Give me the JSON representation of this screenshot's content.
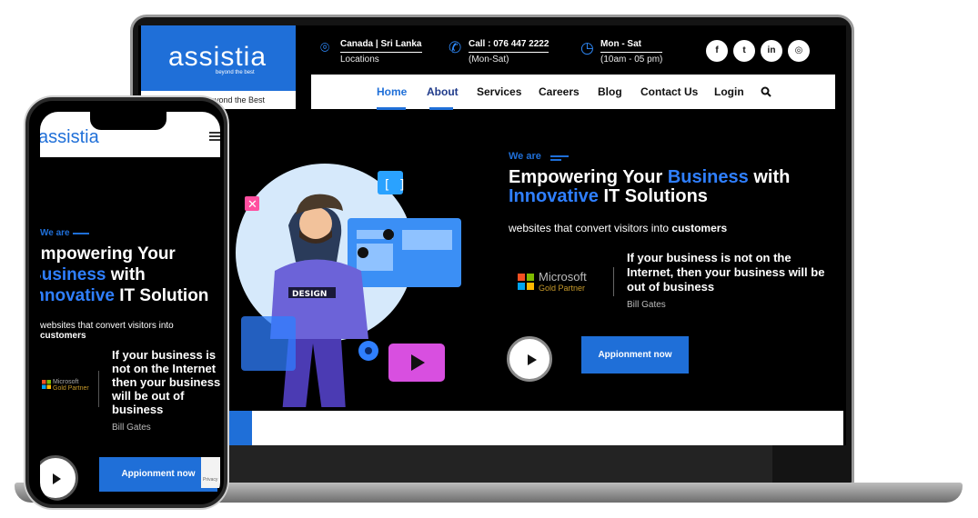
{
  "colors": {
    "brand_blue": "#1f6fd8",
    "background": "#000000",
    "accent_light": "#2f7fff"
  },
  "laptop": {
    "logo": {
      "text": "assistia",
      "sub": "beyond the best",
      "tagline": "Beyond the Best"
    },
    "contact": [
      {
        "icon": "map-pin-icon",
        "line1": "Canada | Sri Lanka",
        "line2": "Locations"
      },
      {
        "icon": "phone-icon",
        "line1": "Call : 076 447 2222",
        "line2": "(Mon-Sat)"
      },
      {
        "icon": "clock-icon",
        "line1": "Mon - Sat",
        "line2": "(10am - 05 pm)"
      }
    ],
    "social": [
      {
        "icon": "facebook-icon",
        "glyph": "f"
      },
      {
        "icon": "twitter-icon",
        "glyph": "t"
      },
      {
        "icon": "linkedin-icon",
        "glyph": "in"
      },
      {
        "icon": "instagram-icon",
        "glyph": "◎"
      }
    ],
    "nav": {
      "items": [
        "Home",
        "About",
        "Services",
        "Careers",
        "Blog",
        "Contact Us",
        "Login"
      ],
      "active": "Home",
      "search_icon": "search-icon"
    },
    "hero": {
      "eyebrow": "We are",
      "title_1": "Empowering Your ",
      "title_2": "Business",
      "title_3": " with",
      "title_4": "Innovative",
      "title_5": " IT Solutions",
      "subtitle_1": "websites that convert visitors into ",
      "subtitle_2": "customers",
      "partner_name": "Microsoft",
      "partner_level": "Gold Partner",
      "quote": "If your business is not on the Internet, then your business will be out of business",
      "quote_author": "Bill Gates",
      "cta": "Appionment now",
      "illustration_badge": "DESIGN"
    }
  },
  "phone": {
    "logo": "assistia",
    "eyebrow": "We are",
    "title_1": "Empowering Your",
    "title_2": "Business",
    "title_3": " with",
    "title_4": "Innovative",
    "title_5": " IT Solution",
    "subtitle_1": "websites that convert visitors into ",
    "subtitle_2": "customers",
    "partner_name": "Microsoft",
    "partner_level": "Gold Partner",
    "quote": "If your business is not on the Internet then your business will be out of business",
    "quote_author": "Bill Gates",
    "cta": "Appionment now",
    "recaptcha": "Privacy"
  }
}
